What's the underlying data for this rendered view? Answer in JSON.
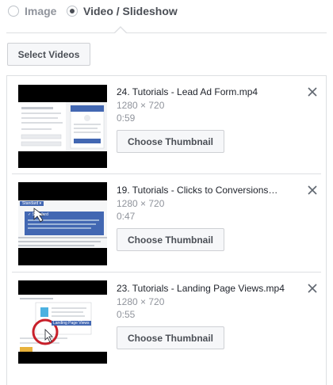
{
  "media_type": {
    "options": [
      {
        "label": "Image",
        "selected": false
      },
      {
        "label": "Video / Slideshow",
        "selected": true
      }
    ]
  },
  "toolbar": {
    "select_videos_label": "Select Videos"
  },
  "videos": [
    {
      "title": "24. Tutorials - Lead Ad Form.mp4",
      "resolution": "1280 × 720",
      "duration": "0:59",
      "button_label": "Choose Thumbnail"
    },
    {
      "title": "19. Tutorials - Clicks to Conversions…",
      "resolution": "1280 × 720",
      "duration": "0:47",
      "button_label": "Choose Thumbnail"
    },
    {
      "title": "23. Tutorials - Landing Page Views.mp4",
      "resolution": "1280 × 720",
      "duration": "0:55",
      "button_label": "Choose Thumbnail"
    }
  ],
  "thumbnail_text": {
    "video2_dropdown": "Standard ▾",
    "video2_option": "✓ Standard",
    "video3_button": "Landing Page Views"
  },
  "colors": {
    "border": "#dddfe2",
    "button_bg": "#f6f7f9",
    "button_text": "#4b4f56",
    "secondary_text": "#90949c",
    "fb_blue": "#4267b2",
    "highlight_red": "#c8202a"
  }
}
